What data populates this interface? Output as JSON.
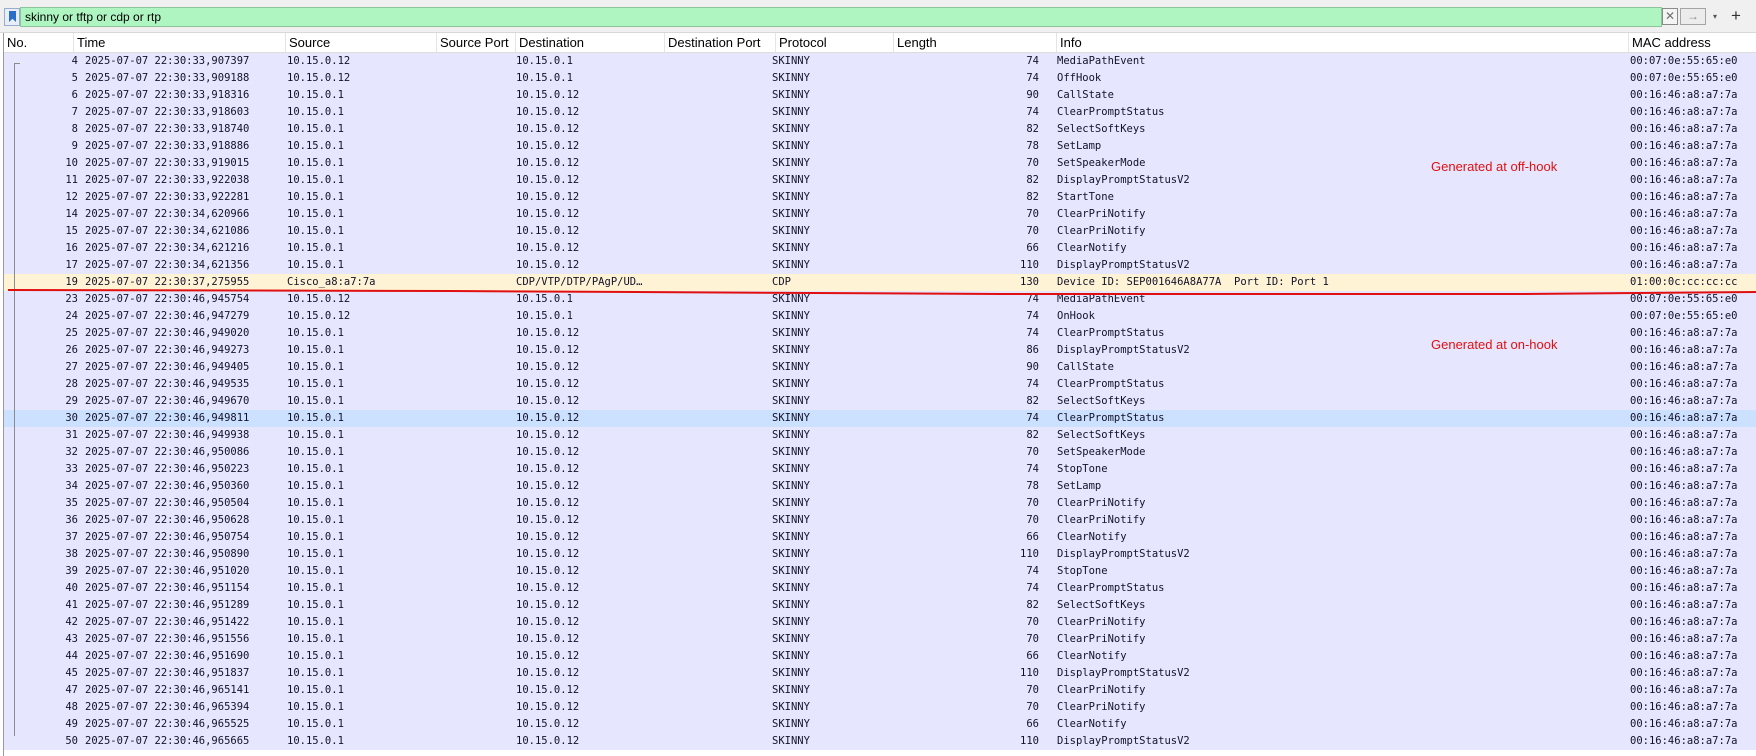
{
  "filter": {
    "value": "skinny or tftp or cdp or rtp",
    "clear_icon": "✕",
    "apply_icon": "→",
    "dropdown_icon": "▾",
    "add_icon": "+"
  },
  "columns": {
    "no": "No.",
    "time": "Time",
    "source": "Source",
    "source_port": "Source Port",
    "destination": "Destination",
    "destination_port": "Destination Port",
    "protocol": "Protocol",
    "length": "Length",
    "info": "Info",
    "mac": "MAC address"
  },
  "colors": {
    "skinny_row": "#e7e6ff",
    "cdp_row": "#fff3d6",
    "selected_row": "#cce0ff",
    "filter_valid": "#aff5c1",
    "annotation_red": "#e01010"
  },
  "selected_packet": "30",
  "annotations": {
    "off_hook": "Generated at off-hook",
    "on_hook": "Generated at on-hook"
  },
  "packets": [
    {
      "no": "4",
      "time": "2025-07-07 22:30:33,907397",
      "src": "10.15.0.12",
      "sport": "",
      "dst": "10.15.0.1",
      "dport": "",
      "proto": "SKINNY",
      "len": "74",
      "info": "MediaPathEvent",
      "mac": "00:07:0e:55:65:e0",
      "type": "skinny"
    },
    {
      "no": "5",
      "time": "2025-07-07 22:30:33,909188",
      "src": "10.15.0.12",
      "sport": "",
      "dst": "10.15.0.1",
      "dport": "",
      "proto": "SKINNY",
      "len": "74",
      "info": "OffHook",
      "mac": "00:07:0e:55:65:e0",
      "type": "skinny"
    },
    {
      "no": "6",
      "time": "2025-07-07 22:30:33,918316",
      "src": "10.15.0.1",
      "sport": "",
      "dst": "10.15.0.12",
      "dport": "",
      "proto": "SKINNY",
      "len": "90",
      "info": "CallState",
      "mac": "00:16:46:a8:a7:7a",
      "type": "skinny"
    },
    {
      "no": "7",
      "time": "2025-07-07 22:30:33,918603",
      "src": "10.15.0.1",
      "sport": "",
      "dst": "10.15.0.12",
      "dport": "",
      "proto": "SKINNY",
      "len": "74",
      "info": "ClearPromptStatus",
      "mac": "00:16:46:a8:a7:7a",
      "type": "skinny"
    },
    {
      "no": "8",
      "time": "2025-07-07 22:30:33,918740",
      "src": "10.15.0.1",
      "sport": "",
      "dst": "10.15.0.12",
      "dport": "",
      "proto": "SKINNY",
      "len": "82",
      "info": "SelectSoftKeys",
      "mac": "00:16:46:a8:a7:7a",
      "type": "skinny"
    },
    {
      "no": "9",
      "time": "2025-07-07 22:30:33,918886",
      "src": "10.15.0.1",
      "sport": "",
      "dst": "10.15.0.12",
      "dport": "",
      "proto": "SKINNY",
      "len": "78",
      "info": "SetLamp",
      "mac": "00:16:46:a8:a7:7a",
      "type": "skinny"
    },
    {
      "no": "10",
      "time": "2025-07-07 22:30:33,919015",
      "src": "10.15.0.1",
      "sport": "",
      "dst": "10.15.0.12",
      "dport": "",
      "proto": "SKINNY",
      "len": "70",
      "info": "SetSpeakerMode",
      "mac": "00:16:46:a8:a7:7a",
      "type": "skinny"
    },
    {
      "no": "11",
      "time": "2025-07-07 22:30:33,922038",
      "src": "10.15.0.1",
      "sport": "",
      "dst": "10.15.0.12",
      "dport": "",
      "proto": "SKINNY",
      "len": "82",
      "info": "DisplayPromptStatusV2",
      "mac": "00:16:46:a8:a7:7a",
      "type": "skinny"
    },
    {
      "no": "12",
      "time": "2025-07-07 22:30:33,922281",
      "src": "10.15.0.1",
      "sport": "",
      "dst": "10.15.0.12",
      "dport": "",
      "proto": "SKINNY",
      "len": "82",
      "info": "StartTone",
      "mac": "00:16:46:a8:a7:7a",
      "type": "skinny"
    },
    {
      "no": "14",
      "time": "2025-07-07 22:30:34,620966",
      "src": "10.15.0.1",
      "sport": "",
      "dst": "10.15.0.12",
      "dport": "",
      "proto": "SKINNY",
      "len": "70",
      "info": "ClearPriNotify",
      "mac": "00:16:46:a8:a7:7a",
      "type": "skinny"
    },
    {
      "no": "15",
      "time": "2025-07-07 22:30:34,621086",
      "src": "10.15.0.1",
      "sport": "",
      "dst": "10.15.0.12",
      "dport": "",
      "proto": "SKINNY",
      "len": "70",
      "info": "ClearPriNotify",
      "mac": "00:16:46:a8:a7:7a",
      "type": "skinny"
    },
    {
      "no": "16",
      "time": "2025-07-07 22:30:34,621216",
      "src": "10.15.0.1",
      "sport": "",
      "dst": "10.15.0.12",
      "dport": "",
      "proto": "SKINNY",
      "len": "66",
      "info": "ClearNotify",
      "mac": "00:16:46:a8:a7:7a",
      "type": "skinny"
    },
    {
      "no": "17",
      "time": "2025-07-07 22:30:34,621356",
      "src": "10.15.0.1",
      "sport": "",
      "dst": "10.15.0.12",
      "dport": "",
      "proto": "SKINNY",
      "len": "110",
      "info": "DisplayPromptStatusV2",
      "mac": "00:16:46:a8:a7:7a",
      "type": "skinny"
    },
    {
      "no": "19",
      "time": "2025-07-07 22:30:37,275955",
      "src": "Cisco_a8:a7:7a",
      "sport": "",
      "dst": "CDP/VTP/DTP/PAgP/UD…",
      "dport": "",
      "proto": "CDP",
      "len": "130",
      "info": "Device ID: SEP001646A8A77A  Port ID: Port 1",
      "mac": "01:00:0c:cc:cc:cc",
      "type": "cdp"
    },
    {
      "no": "23",
      "time": "2025-07-07 22:30:46,945754",
      "src": "10.15.0.12",
      "sport": "",
      "dst": "10.15.0.1",
      "dport": "",
      "proto": "SKINNY",
      "len": "74",
      "info": "MediaPathEvent",
      "mac": "00:07:0e:55:65:e0",
      "type": "skinny"
    },
    {
      "no": "24",
      "time": "2025-07-07 22:30:46,947279",
      "src": "10.15.0.12",
      "sport": "",
      "dst": "10.15.0.1",
      "dport": "",
      "proto": "SKINNY",
      "len": "74",
      "info": "OnHook",
      "mac": "00:07:0e:55:65:e0",
      "type": "skinny"
    },
    {
      "no": "25",
      "time": "2025-07-07 22:30:46,949020",
      "src": "10.15.0.1",
      "sport": "",
      "dst": "10.15.0.12",
      "dport": "",
      "proto": "SKINNY",
      "len": "74",
      "info": "ClearPromptStatus",
      "mac": "00:16:46:a8:a7:7a",
      "type": "skinny"
    },
    {
      "no": "26",
      "time": "2025-07-07 22:30:46,949273",
      "src": "10.15.0.1",
      "sport": "",
      "dst": "10.15.0.12",
      "dport": "",
      "proto": "SKINNY",
      "len": "86",
      "info": "DisplayPromptStatusV2",
      "mac": "00:16:46:a8:a7:7a",
      "type": "skinny"
    },
    {
      "no": "27",
      "time": "2025-07-07 22:30:46,949405",
      "src": "10.15.0.1",
      "sport": "",
      "dst": "10.15.0.12",
      "dport": "",
      "proto": "SKINNY",
      "len": "90",
      "info": "CallState",
      "mac": "00:16:46:a8:a7:7a",
      "type": "skinny"
    },
    {
      "no": "28",
      "time": "2025-07-07 22:30:46,949535",
      "src": "10.15.0.1",
      "sport": "",
      "dst": "10.15.0.12",
      "dport": "",
      "proto": "SKINNY",
      "len": "74",
      "info": "ClearPromptStatus",
      "mac": "00:16:46:a8:a7:7a",
      "type": "skinny"
    },
    {
      "no": "29",
      "time": "2025-07-07 22:30:46,949670",
      "src": "10.15.0.1",
      "sport": "",
      "dst": "10.15.0.12",
      "dport": "",
      "proto": "SKINNY",
      "len": "82",
      "info": "SelectSoftKeys",
      "mac": "00:16:46:a8:a7:7a",
      "type": "skinny"
    },
    {
      "no": "30",
      "time": "2025-07-07 22:30:46,949811",
      "src": "10.15.0.1",
      "sport": "",
      "dst": "10.15.0.12",
      "dport": "",
      "proto": "SKINNY",
      "len": "74",
      "info": "ClearPromptStatus",
      "mac": "00:16:46:a8:a7:7a",
      "type": "skinny"
    },
    {
      "no": "31",
      "time": "2025-07-07 22:30:46,949938",
      "src": "10.15.0.1",
      "sport": "",
      "dst": "10.15.0.12",
      "dport": "",
      "proto": "SKINNY",
      "len": "82",
      "info": "SelectSoftKeys",
      "mac": "00:16:46:a8:a7:7a",
      "type": "skinny"
    },
    {
      "no": "32",
      "time": "2025-07-07 22:30:46,950086",
      "src": "10.15.0.1",
      "sport": "",
      "dst": "10.15.0.12",
      "dport": "",
      "proto": "SKINNY",
      "len": "70",
      "info": "SetSpeakerMode",
      "mac": "00:16:46:a8:a7:7a",
      "type": "skinny"
    },
    {
      "no": "33",
      "time": "2025-07-07 22:30:46,950223",
      "src": "10.15.0.1",
      "sport": "",
      "dst": "10.15.0.12",
      "dport": "",
      "proto": "SKINNY",
      "len": "74",
      "info": "StopTone",
      "mac": "00:16:46:a8:a7:7a",
      "type": "skinny"
    },
    {
      "no": "34",
      "time": "2025-07-07 22:30:46,950360",
      "src": "10.15.0.1",
      "sport": "",
      "dst": "10.15.0.12",
      "dport": "",
      "proto": "SKINNY",
      "len": "78",
      "info": "SetLamp",
      "mac": "00:16:46:a8:a7:7a",
      "type": "skinny"
    },
    {
      "no": "35",
      "time": "2025-07-07 22:30:46,950504",
      "src": "10.15.0.1",
      "sport": "",
      "dst": "10.15.0.12",
      "dport": "",
      "proto": "SKINNY",
      "len": "70",
      "info": "ClearPriNotify",
      "mac": "00:16:46:a8:a7:7a",
      "type": "skinny"
    },
    {
      "no": "36",
      "time": "2025-07-07 22:30:46,950628",
      "src": "10.15.0.1",
      "sport": "",
      "dst": "10.15.0.12",
      "dport": "",
      "proto": "SKINNY",
      "len": "70",
      "info": "ClearPriNotify",
      "mac": "00:16:46:a8:a7:7a",
      "type": "skinny"
    },
    {
      "no": "37",
      "time": "2025-07-07 22:30:46,950754",
      "src": "10.15.0.1",
      "sport": "",
      "dst": "10.15.0.12",
      "dport": "",
      "proto": "SKINNY",
      "len": "66",
      "info": "ClearNotify",
      "mac": "00:16:46:a8:a7:7a",
      "type": "skinny"
    },
    {
      "no": "38",
      "time": "2025-07-07 22:30:46,950890",
      "src": "10.15.0.1",
      "sport": "",
      "dst": "10.15.0.12",
      "dport": "",
      "proto": "SKINNY",
      "len": "110",
      "info": "DisplayPromptStatusV2",
      "mac": "00:16:46:a8:a7:7a",
      "type": "skinny"
    },
    {
      "no": "39",
      "time": "2025-07-07 22:30:46,951020",
      "src": "10.15.0.1",
      "sport": "",
      "dst": "10.15.0.12",
      "dport": "",
      "proto": "SKINNY",
      "len": "74",
      "info": "StopTone",
      "mac": "00:16:46:a8:a7:7a",
      "type": "skinny"
    },
    {
      "no": "40",
      "time": "2025-07-07 22:30:46,951154",
      "src": "10.15.0.1",
      "sport": "",
      "dst": "10.15.0.12",
      "dport": "",
      "proto": "SKINNY",
      "len": "74",
      "info": "ClearPromptStatus",
      "mac": "00:16:46:a8:a7:7a",
      "type": "skinny"
    },
    {
      "no": "41",
      "time": "2025-07-07 22:30:46,951289",
      "src": "10.15.0.1",
      "sport": "",
      "dst": "10.15.0.12",
      "dport": "",
      "proto": "SKINNY",
      "len": "82",
      "info": "SelectSoftKeys",
      "mac": "00:16:46:a8:a7:7a",
      "type": "skinny"
    },
    {
      "no": "42",
      "time": "2025-07-07 22:30:46,951422",
      "src": "10.15.0.1",
      "sport": "",
      "dst": "10.15.0.12",
      "dport": "",
      "proto": "SKINNY",
      "len": "70",
      "info": "ClearPriNotify",
      "mac": "00:16:46:a8:a7:7a",
      "type": "skinny"
    },
    {
      "no": "43",
      "time": "2025-07-07 22:30:46,951556",
      "src": "10.15.0.1",
      "sport": "",
      "dst": "10.15.0.12",
      "dport": "",
      "proto": "SKINNY",
      "len": "70",
      "info": "ClearPriNotify",
      "mac": "00:16:46:a8:a7:7a",
      "type": "skinny"
    },
    {
      "no": "44",
      "time": "2025-07-07 22:30:46,951690",
      "src": "10.15.0.1",
      "sport": "",
      "dst": "10.15.0.12",
      "dport": "",
      "proto": "SKINNY",
      "len": "66",
      "info": "ClearNotify",
      "mac": "00:16:46:a8:a7:7a",
      "type": "skinny"
    },
    {
      "no": "45",
      "time": "2025-07-07 22:30:46,951837",
      "src": "10.15.0.1",
      "sport": "",
      "dst": "10.15.0.12",
      "dport": "",
      "proto": "SKINNY",
      "len": "110",
      "info": "DisplayPromptStatusV2",
      "mac": "00:16:46:a8:a7:7a",
      "type": "skinny"
    },
    {
      "no": "47",
      "time": "2025-07-07 22:30:46,965141",
      "src": "10.15.0.1",
      "sport": "",
      "dst": "10.15.0.12",
      "dport": "",
      "proto": "SKINNY",
      "len": "70",
      "info": "ClearPriNotify",
      "mac": "00:16:46:a8:a7:7a",
      "type": "skinny"
    },
    {
      "no": "48",
      "time": "2025-07-07 22:30:46,965394",
      "src": "10.15.0.1",
      "sport": "",
      "dst": "10.15.0.12",
      "dport": "",
      "proto": "SKINNY",
      "len": "70",
      "info": "ClearPriNotify",
      "mac": "00:16:46:a8:a7:7a",
      "type": "skinny"
    },
    {
      "no": "49",
      "time": "2025-07-07 22:30:46,965525",
      "src": "10.15.0.1",
      "sport": "",
      "dst": "10.15.0.12",
      "dport": "",
      "proto": "SKINNY",
      "len": "66",
      "info": "ClearNotify",
      "mac": "00:16:46:a8:a7:7a",
      "type": "skinny"
    },
    {
      "no": "50",
      "time": "2025-07-07 22:30:46,965665",
      "src": "10.15.0.1",
      "sport": "",
      "dst": "10.15.0.12",
      "dport": "",
      "proto": "SKINNY",
      "len": "110",
      "info": "DisplayPromptStatusV2",
      "mac": "00:16:46:a8:a7:7a",
      "type": "skinny"
    }
  ]
}
